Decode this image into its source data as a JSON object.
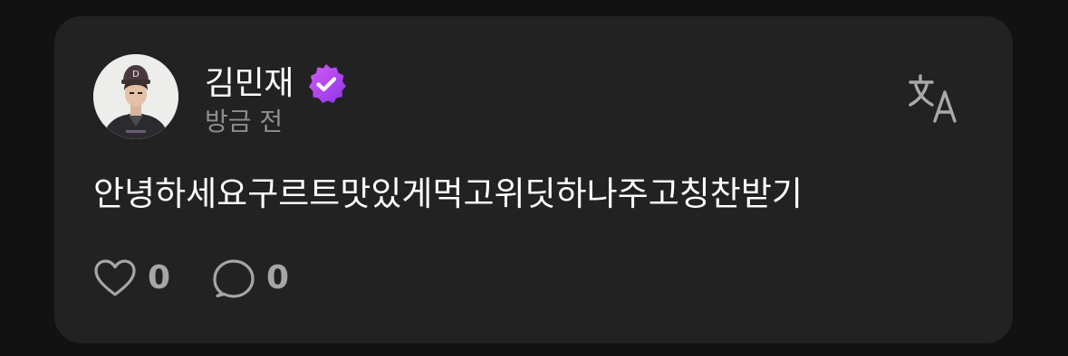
{
  "post": {
    "author_name": "김민재",
    "timestamp": "방금 전",
    "body": "안녕하세요구르트맛있게먹고위딧하나주고칭찬받기",
    "likes": "0",
    "comments": "0"
  },
  "icons": {
    "verified": "verified-badge-icon",
    "translate": "translate-icon",
    "like": "heart-icon",
    "comment": "speech-bubble-icon"
  },
  "colors": {
    "card_background": "#222222",
    "page_background": "#121212",
    "badge_gradient_start": "#c64bf2",
    "badge_gradient_end": "#8a34e8",
    "secondary_text": "#8f8f8f"
  }
}
